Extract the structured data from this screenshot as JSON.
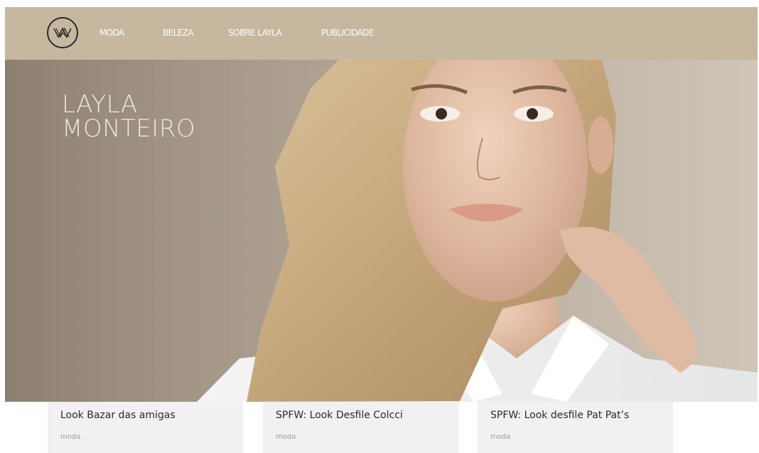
{
  "nav": {
    "logo_icon": "layla-monteiro-logo-icon",
    "items": [
      {
        "label": "MODA"
      },
      {
        "label": "BELEZA"
      },
      {
        "label": "SOBRE LAYLA"
      },
      {
        "label": "PUBLICIDADE"
      }
    ]
  },
  "hero": {
    "title_line1": "LAYLA",
    "title_line2": "MONTEIRO",
    "image_icon": "model-portrait-photo"
  },
  "posts": [
    {
      "title": "Look Bazar das amigas",
      "category": "moda"
    },
    {
      "title": "SPFW: Look Desfile Colcci",
      "category": "moda"
    },
    {
      "title": "SPFW: Look desfile Pat Pat’s",
      "category": "moda"
    }
  ],
  "colors": {
    "navbar": "#c5b89f",
    "card_bg": "#f1f1f1",
    "card_title": "#2a2a2a",
    "card_category": "#9a9a9a"
  }
}
